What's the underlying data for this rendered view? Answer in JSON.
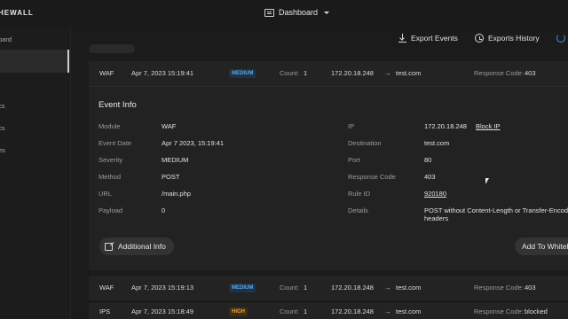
{
  "topbar": {
    "brand": "HEWALL",
    "dashboard_label": "Dashboard"
  },
  "sidebar": {
    "items": [
      "oard",
      "",
      "cs",
      "cs",
      "es"
    ]
  },
  "toolbar": {
    "export_events": "Export Events",
    "exports_history": "Exports History"
  },
  "rows": [
    {
      "type": "WAF",
      "date": "Apr 7, 2023 15:19:41",
      "severity": "MEDIUM",
      "count_label": "Count:",
      "count": "1",
      "ip": "172.20.18.248",
      "arrow": "→",
      "destination": "test.com",
      "response_label": "Response Code:",
      "response": "403"
    },
    {
      "type": "WAF",
      "date": "Apr 7, 2023 15:19:13",
      "severity": "MEDIUM",
      "count_label": "Count:",
      "count": "1",
      "ip": "172.20.18.248",
      "arrow": "→",
      "destination": "test.com",
      "response_label": "Response Code:",
      "response": "403"
    },
    {
      "type": "IPS",
      "date": "Apr 7, 2023 15:18:49",
      "severity": "HIGH",
      "count_label": "Count:",
      "count": "1",
      "ip": "172.20.18.248",
      "arrow": "→",
      "destination": "test.com",
      "response_label": "Response Code:",
      "response": "blocked"
    }
  ],
  "event_info": {
    "title": "Event Info",
    "left": [
      {
        "key": "Module",
        "value": "WAF"
      },
      {
        "key": "Event Date",
        "value": "Apr 7 2023, 15:19:41"
      },
      {
        "key": "Severity",
        "value": "MEDIUM"
      },
      {
        "key": "Method",
        "value": "POST"
      },
      {
        "key": "URL",
        "value": "/main.php"
      },
      {
        "key": "Payload",
        "value": "0"
      }
    ],
    "right": [
      {
        "key": "IP",
        "value": "172.20.18.248",
        "link": "Block IP"
      },
      {
        "key": "Destination",
        "value": "test.com"
      },
      {
        "key": "Port",
        "value": "80"
      },
      {
        "key": "Response Code",
        "value": "403"
      },
      {
        "key": "Rule ID",
        "value": "920180"
      },
      {
        "key": "Details",
        "value": "POST without Content-Length or Transfer-Encoding",
        "value2": "headers"
      }
    ],
    "additional_info": "Additional Info",
    "add_to_whitelist": "Add To Whitelist"
  },
  "colors": {
    "link": "#5b96e6",
    "medium": "#5aa7e6",
    "high": "#e6a53a"
  }
}
